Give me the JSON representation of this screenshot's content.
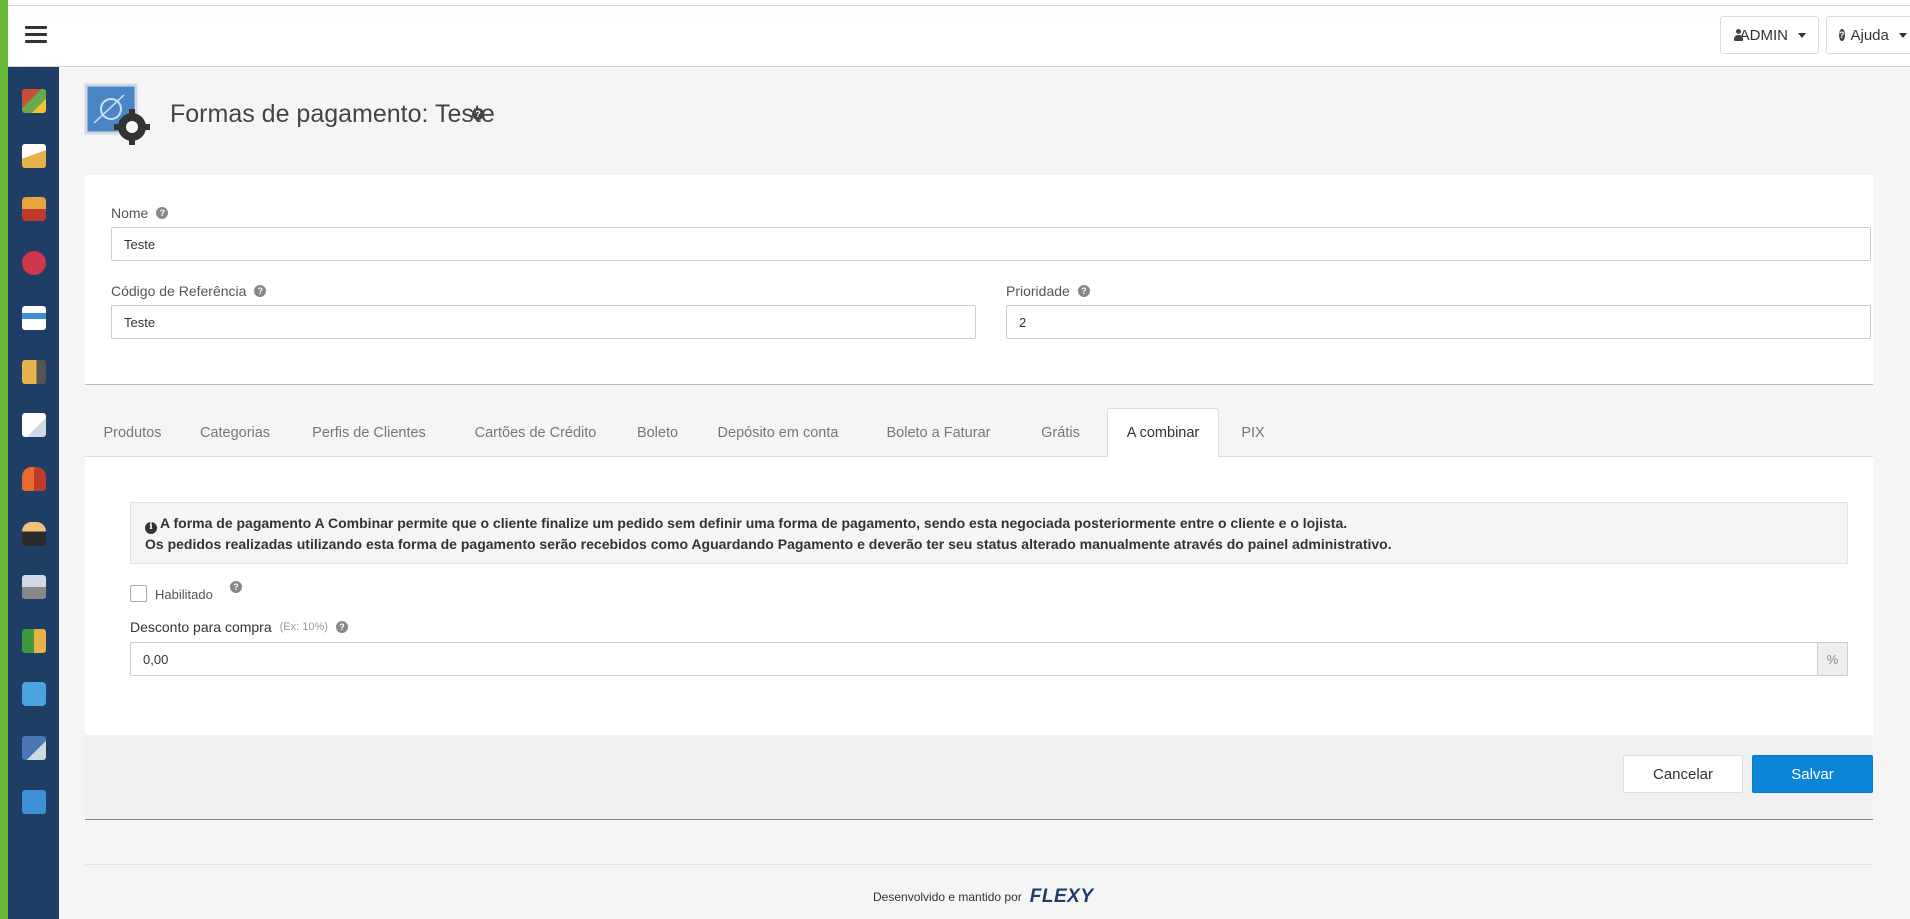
{
  "navbar": {
    "admin_label": "ADMIN",
    "help_label": "Ajuda"
  },
  "page": {
    "title": "Formas de pagamento: Teste"
  },
  "form": {
    "nome_label": "Nome",
    "nome_value": "Teste",
    "codigo_label": "Código de Referência",
    "codigo_value": "Teste",
    "prioridade_label": "Prioridade",
    "prioridade_value": "2"
  },
  "tabs": [
    {
      "label": "Produtos"
    },
    {
      "label": "Categorias"
    },
    {
      "label": "Perfis de Clientes"
    },
    {
      "label": "Cartões de Crédito"
    },
    {
      "label": "Boleto"
    },
    {
      "label": "Depósito em conta"
    },
    {
      "label": "Boleto a Faturar"
    },
    {
      "label": "Grátis"
    },
    {
      "label": "A combinar"
    },
    {
      "label": "PIX"
    }
  ],
  "combinar": {
    "info_line1": "A forma de pagamento A Combinar permite que o cliente finalize um pedido sem definir uma forma de pagamento, sendo esta negociada posteriormente entre o cliente e o lojista.",
    "info_line2": "Os pedidos realizadas utilizando esta forma de pagamento serão recebidos como Aguardando Pagamento e deverão ter seu status alterado manualmente através do painel administrativo.",
    "enabled_label": "Habilitado",
    "discount_label": "Desconto para compra",
    "discount_hint": "(Ex: 10%)",
    "discount_value": "0,00",
    "discount_addon": "%"
  },
  "actions": {
    "cancel_label": "Cancelar",
    "save_label": "Salvar"
  },
  "footer": {
    "text": "Desenvolvido e mantido por",
    "brand": "FLEXY"
  },
  "colors": {
    "sidebar": "#1f3e66",
    "accent_green": "#6aba3a",
    "primary": "#0a85d8"
  }
}
